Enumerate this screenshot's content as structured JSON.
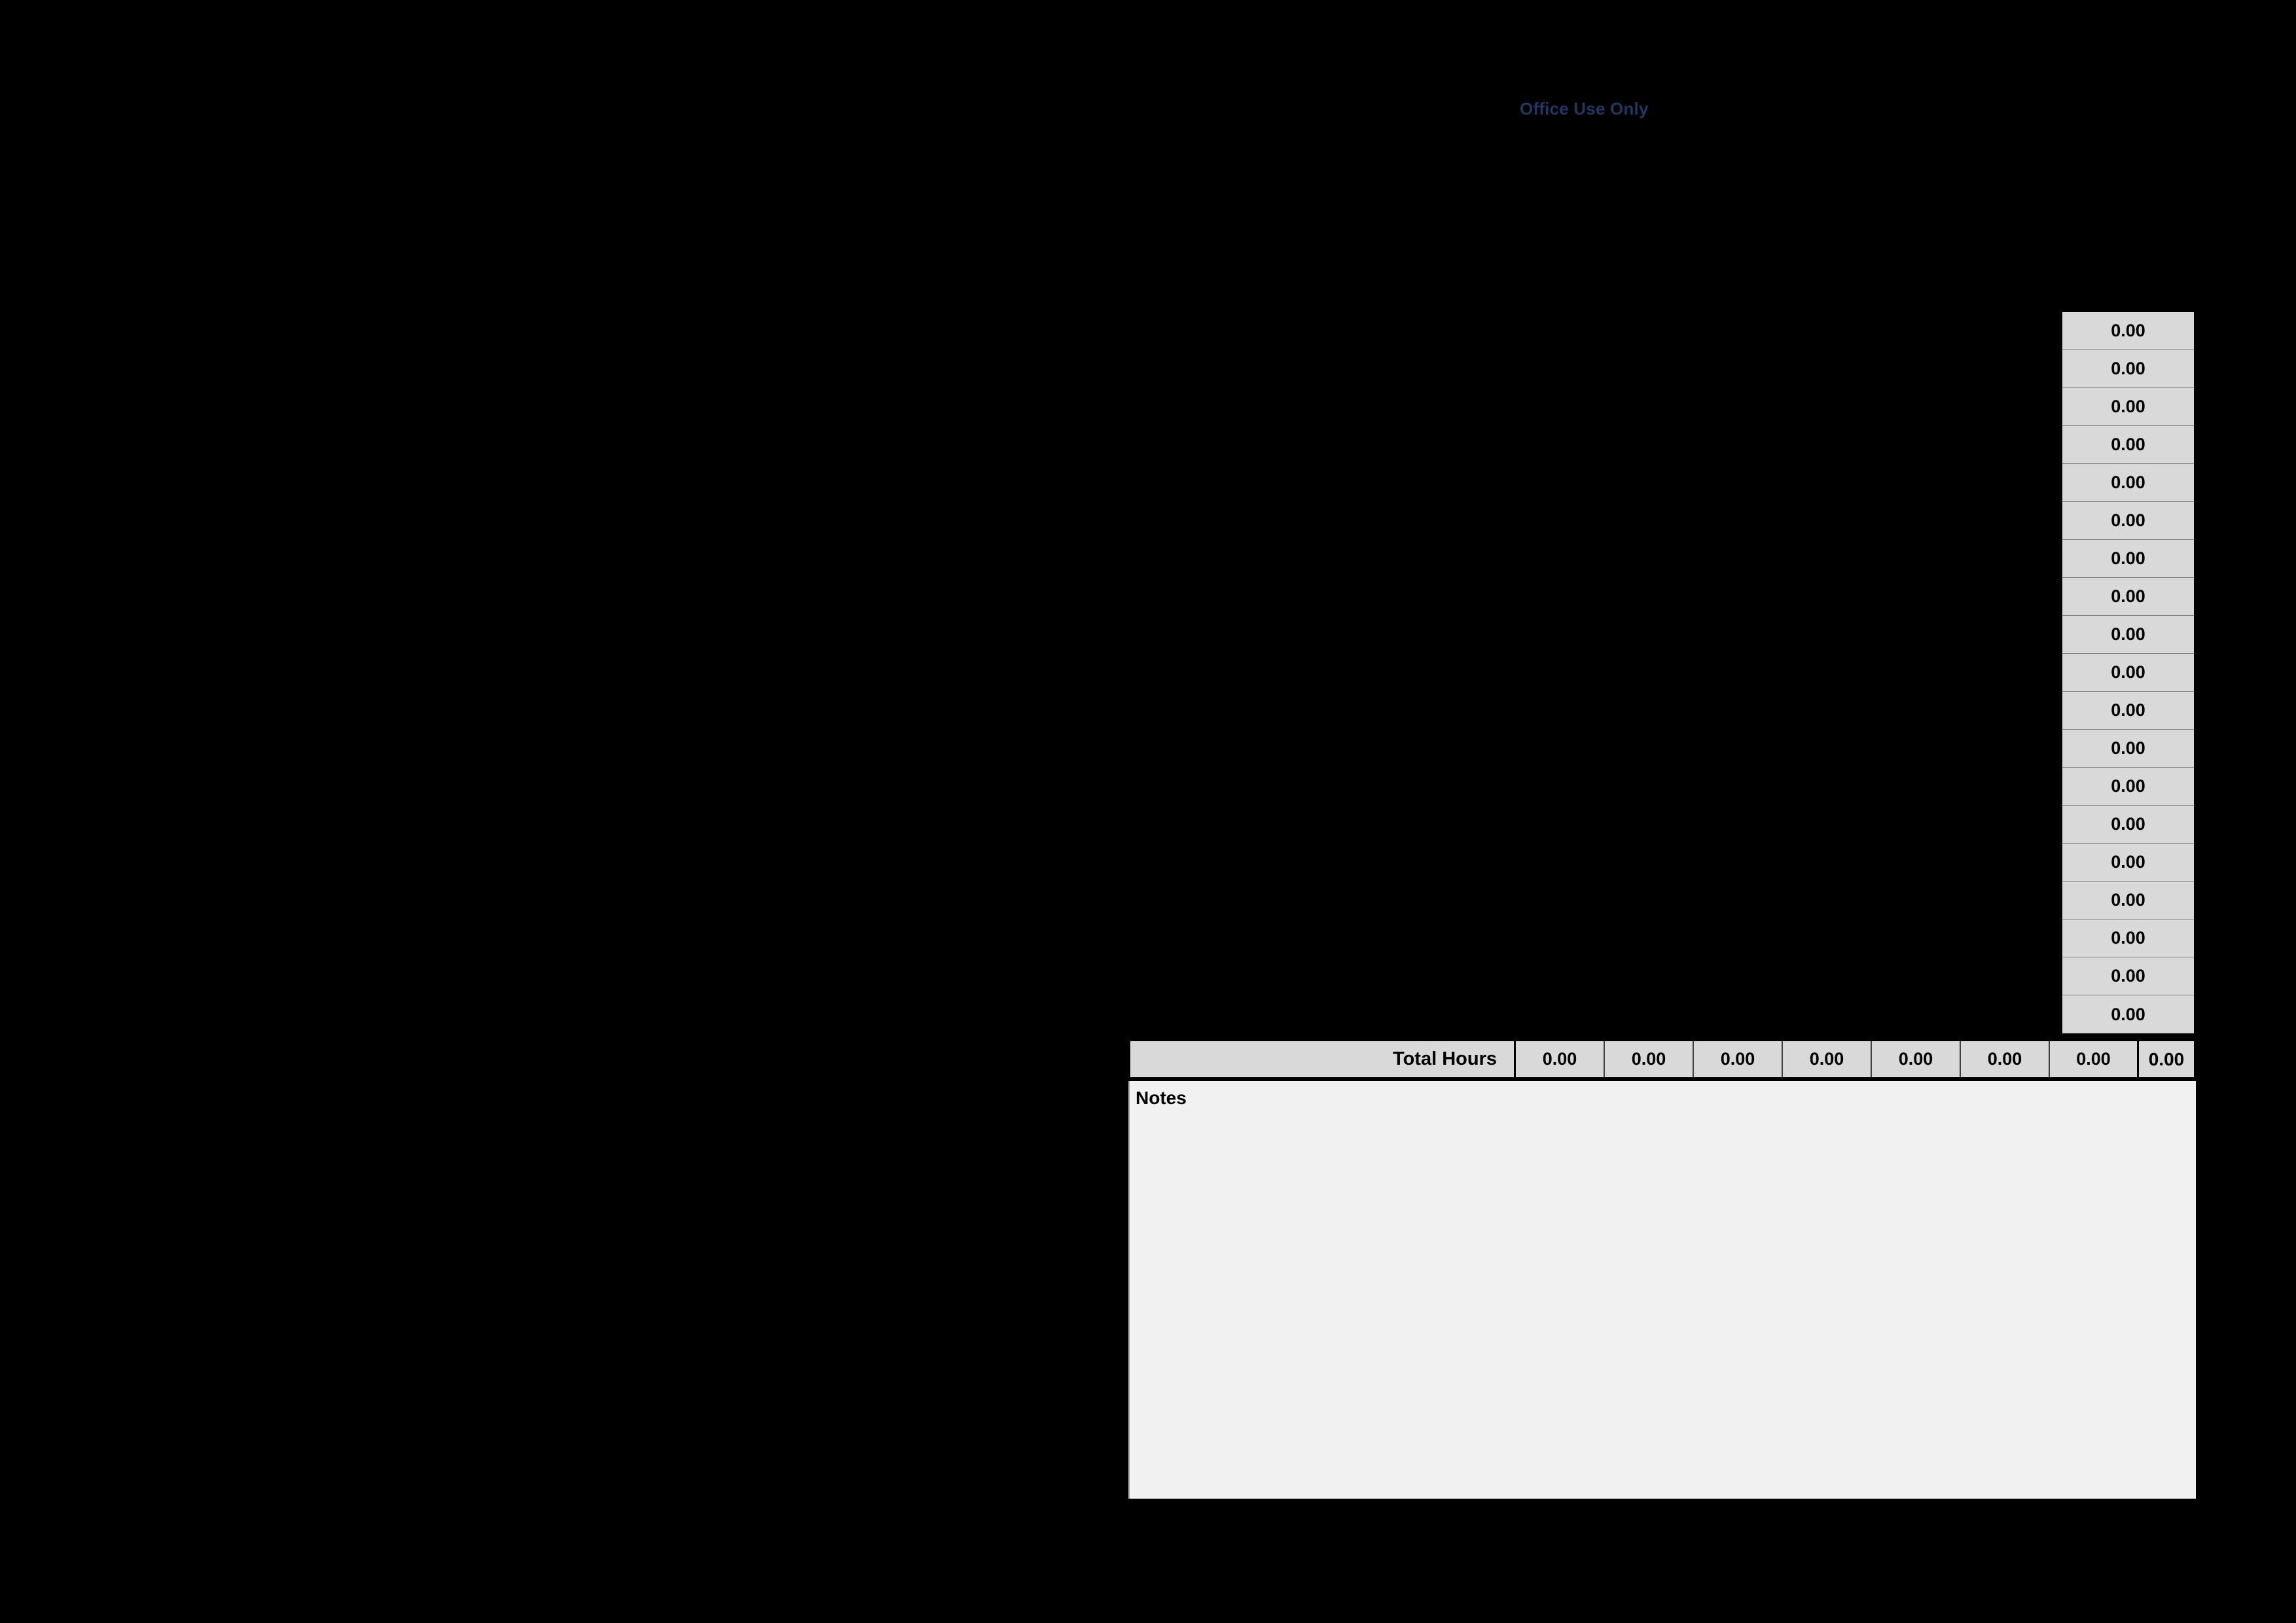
{
  "form": {
    "office_use_label": "Office Use Only"
  },
  "daily_totals_column": {
    "name": "daily-hour-totals",
    "values": [
      "0.00",
      "0.00",
      "0.00",
      "0.00",
      "0.00",
      "0.00",
      "0.00",
      "0.00",
      "0.00",
      "0.00",
      "0.00",
      "0.00",
      "0.00",
      "0.00",
      "0.00",
      "0.00",
      "0.00",
      "0.00",
      "0.00"
    ]
  },
  "total_hours_row": {
    "label": "Total Hours",
    "day_totals": [
      "0.00",
      "0.00",
      "0.00",
      "0.00",
      "0.00",
      "0.00",
      "0.00"
    ],
    "grand_total": "0.00"
  },
  "notes": {
    "label": "Notes",
    "value": ""
  },
  "colors": {
    "office_use_text": "#1f3864",
    "cell_fill": "#d9d9d9",
    "notes_fill": "#f1f1f1",
    "border": "#000000",
    "page_background": "#000000"
  }
}
